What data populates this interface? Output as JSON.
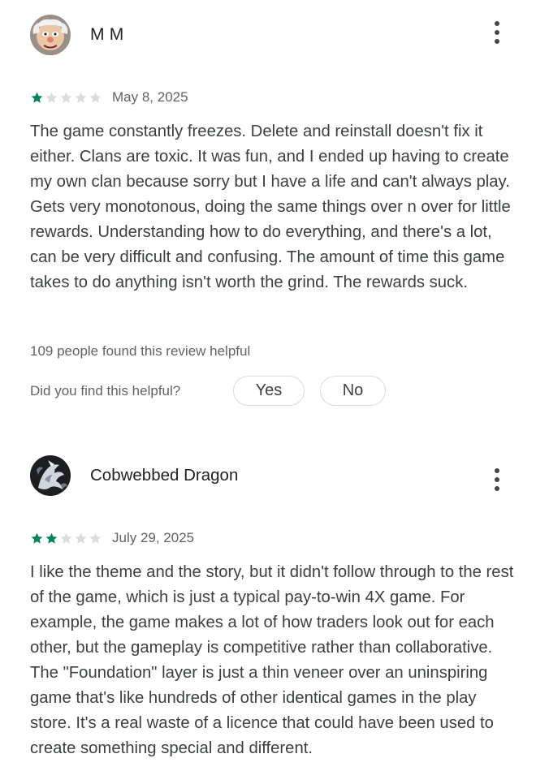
{
  "reviews": [
    {
      "author": "M M",
      "avatar_icon": "cartoon-character-avatar",
      "rating": 1,
      "max_rating": 5,
      "date": "May 8, 2025",
      "text": "The game constantly freezes. Delete and reinstall doesn't fix it either. Clans are toxic. It was fun, and I ended up having to create my own clan because sorry but I have a life and can't always play. Gets very monotonous, doing the same things over n over for little rewards. Understanding how to do everything, and there's a lot, can be very difficult and confusing. The amount of time this game takes to do anything isn't worth the grind. The rewards suck.",
      "helpful_count": "109 people found this review helpful",
      "helpful_question": "Did you find this helpful?",
      "yes_label": "Yes",
      "no_label": "No"
    },
    {
      "author": "Cobwebbed Dragon",
      "avatar_icon": "dragon-avatar",
      "rating": 2,
      "max_rating": 5,
      "date": "July 29, 2025",
      "text": "I like the theme and the story, but it didn't follow through to the rest of the game, which is just a typical pay-to-win 4X game. For example, the game makes a lot of how traders look out for each other, but the gameplay is competitive rather than collaborative. The \"Foundation\" layer is just a thin veneer over an uninspiring game that's like hundreds of other identical games in the play store. It's a real waste of a licence that could have been used to create something special and different."
    }
  ],
  "colors": {
    "star_filled": "#01875f",
    "star_empty": "#dadce0",
    "text": "#3c4043",
    "secondary_text": "#5f6368"
  },
  "icons": {
    "more": "more-vert-icon",
    "star": "star-icon"
  }
}
